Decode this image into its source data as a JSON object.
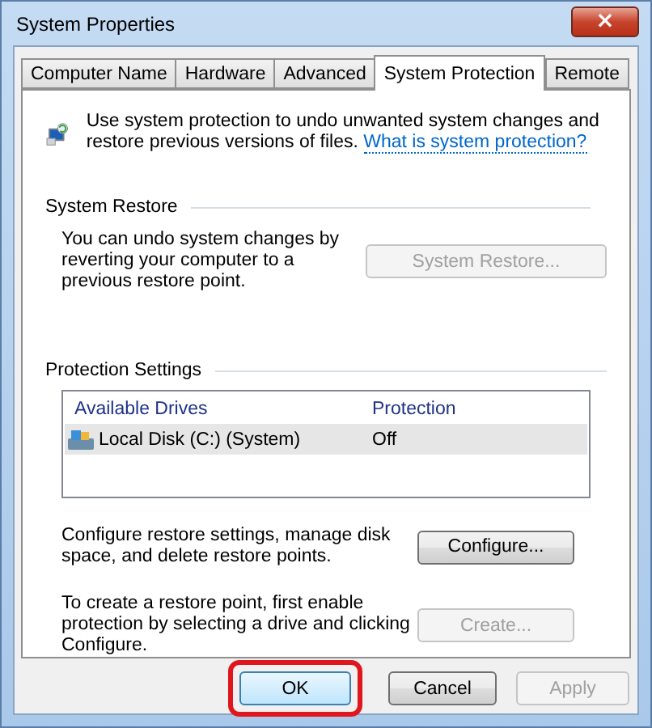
{
  "window": {
    "title": "System Properties",
    "close": "×"
  },
  "tabs": [
    {
      "label": "Computer Name",
      "selected": false
    },
    {
      "label": "Hardware",
      "selected": false
    },
    {
      "label": "Advanced",
      "selected": false
    },
    {
      "label": "System Protection",
      "selected": true
    },
    {
      "label": "Remote",
      "selected": false
    }
  ],
  "intro": {
    "text": "Use system protection to undo unwanted system changes and restore previous versions of files.",
    "link": "What is system protection?"
  },
  "system_restore": {
    "heading": "System Restore",
    "text": "You can undo system changes by reverting your computer to a previous restore point.",
    "button": {
      "label": "System Restore...",
      "disabled": true
    }
  },
  "protection_settings": {
    "heading": "Protection Settings",
    "columns": [
      "Available Drives",
      "Protection"
    ],
    "rows": [
      {
        "drive": "Local Disk (C:) (System)",
        "protection": "Off",
        "selected": true
      }
    ],
    "actions": [
      {
        "text": "Configure restore settings, manage disk space, and delete restore points.",
        "button": {
          "label": "Configure...",
          "disabled": false
        }
      },
      {
        "text": "To create a restore point, first enable protection by selecting a drive and clicking Configure.",
        "button": {
          "label": "Create...",
          "disabled": true
        }
      }
    ]
  },
  "buttons": [
    {
      "label": "OK",
      "disabled": false,
      "default": true,
      "highlighted": true
    },
    {
      "label": "Cancel",
      "disabled": false,
      "default": false,
      "highlighted": false
    },
    {
      "label": "Apply",
      "disabled": true,
      "default": false,
      "highlighted": false
    }
  ]
}
